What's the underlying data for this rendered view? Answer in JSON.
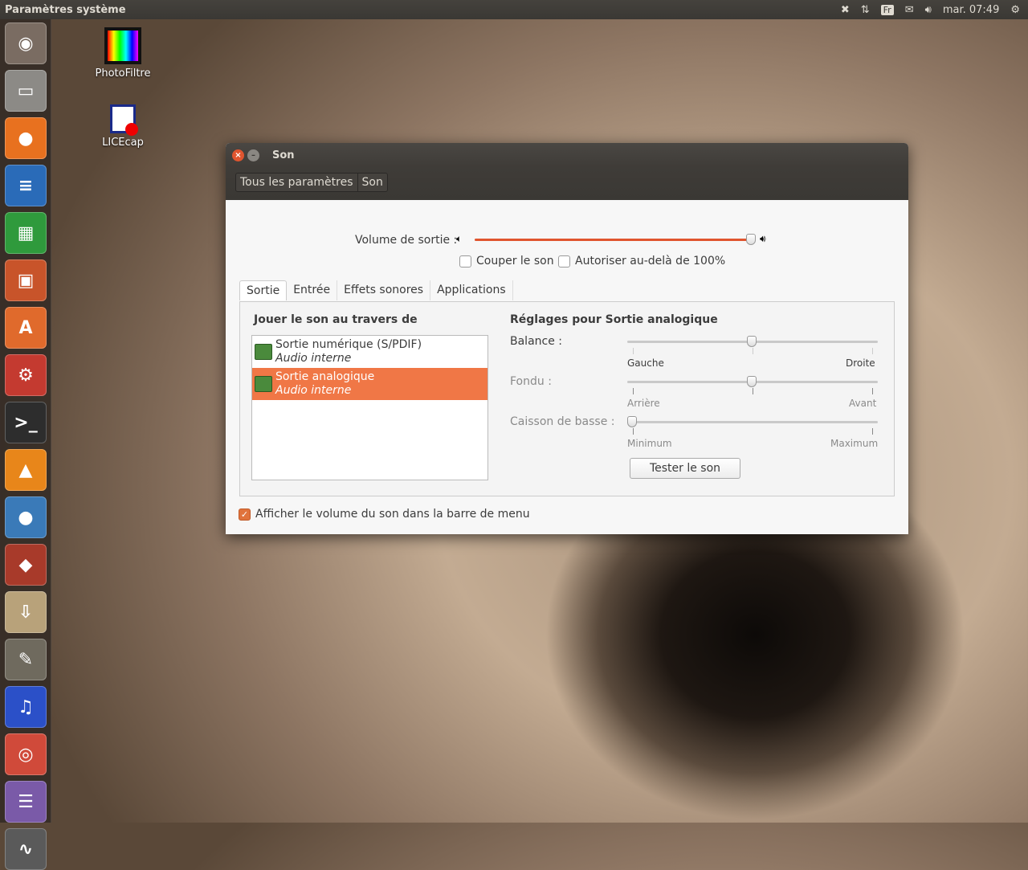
{
  "topbar": {
    "title": "Paramètres système",
    "keyboard": "Fr",
    "clock": "mar. 07:49",
    "icons": [
      "dropbox-icon",
      "network-icon",
      "keyboard-layout-icon",
      "mail-icon",
      "volume-icon",
      "power-gear-icon"
    ]
  },
  "launcher": [
    {
      "name": "ubuntu-dash",
      "glyph": "◉",
      "color": "#7a6c62"
    },
    {
      "name": "files",
      "glyph": "▭",
      "color": "#8c8a86"
    },
    {
      "name": "firefox",
      "glyph": "●",
      "color": "#e8711f"
    },
    {
      "name": "writer",
      "glyph": "≡",
      "color": "#2a6bb8"
    },
    {
      "name": "calc",
      "glyph": "▦",
      "color": "#2f9a3c"
    },
    {
      "name": "impress",
      "glyph": "▣",
      "color": "#c8542a"
    },
    {
      "name": "software-center",
      "glyph": "A",
      "color": "#e06a2c"
    },
    {
      "name": "system-settings",
      "glyph": "⚙",
      "color": "#c43a30"
    },
    {
      "name": "terminal",
      "glyph": ">_",
      "color": "#2d2d2d"
    },
    {
      "name": "vlc",
      "glyph": "▲",
      "color": "#e8861a"
    },
    {
      "name": "penguin-app",
      "glyph": "●",
      "color": "#3a7ab8"
    },
    {
      "name": "kart-game",
      "glyph": "◆",
      "color": "#a83a2a"
    },
    {
      "name": "archive-installer",
      "glyph": "⇩",
      "color": "#b8a27a"
    },
    {
      "name": "gimp",
      "glyph": "✎",
      "color": "#6f6a5e"
    },
    {
      "name": "audacity",
      "glyph": "♫",
      "color": "#2b50c8"
    },
    {
      "name": "chrome",
      "glyph": "◎",
      "color": "#d04a3a"
    },
    {
      "name": "stacks",
      "glyph": "☰",
      "color": "#7a5aa8"
    },
    {
      "name": "system-monitor",
      "glyph": "∿",
      "color": "#5a5a5a"
    }
  ],
  "desktop": [
    {
      "label": "PhotoFiltre"
    },
    {
      "label": "LICEcap"
    }
  ],
  "window": {
    "title": "Son",
    "breadcrumb": [
      "Tous les paramètres",
      "Son"
    ],
    "volume_label": "Volume de sortie :",
    "volume_level": 100,
    "mute_label": "Couper le son",
    "overamp_label": "Autoriser au-delà de 100%",
    "tabs": [
      "Sortie",
      "Entrée",
      "Effets sonores",
      "Applications"
    ],
    "devices_heading": "Jouer le son au travers de",
    "devices": [
      {
        "name": "Sortie numérique (S/PDIF)",
        "sub": "Audio interne",
        "selected": false
      },
      {
        "name": "Sortie analogique",
        "sub": "Audio interne",
        "selected": true
      }
    ],
    "settings_heading": "Réglages pour Sortie analogique",
    "balance": {
      "label": "Balance :",
      "min": "Gauche",
      "max": "Droite",
      "value": 0.5
    },
    "fade": {
      "label": "Fondu :",
      "min": "Arrière",
      "max": "Avant",
      "value": 0.5
    },
    "subwoofer": {
      "label": "Caisson de basse :",
      "min": "Minimum",
      "max": "Maximum",
      "value": 0
    },
    "test_button": "Tester le son",
    "show_volume_label": "Afficher le volume du son dans la barre de menu",
    "show_volume_checked": true,
    "accent": "#f07746"
  }
}
